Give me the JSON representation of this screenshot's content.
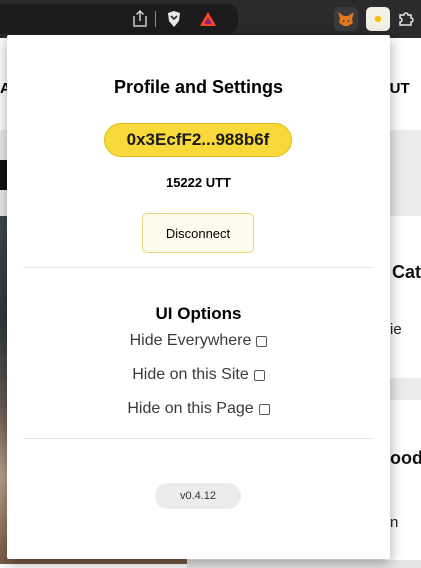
{
  "browser": {
    "toolbar_icons": [
      "share-icon",
      "brave-shield-icon",
      "brave-rewards-icon",
      "metamask-fox-icon",
      "extension-active-icon",
      "extensions-puzzle-icon"
    ]
  },
  "background_page": {
    "nav_left": "AV",
    "nav_right": "OUT",
    "heading_1": "Cat",
    "text_1": "ie",
    "heading_2": "ood",
    "text_2": "n"
  },
  "popup": {
    "title": "Profile and Settings",
    "wallet_address": "0x3EcfF2...988b6f",
    "balance": "15222 UTT",
    "disconnect_label": "Disconnect",
    "ui_options_title": "UI Options",
    "options": [
      {
        "label": "Hide Everywhere",
        "checked": false
      },
      {
        "label": "Hide on this Site",
        "checked": false
      },
      {
        "label": "Hide on this Page",
        "checked": false
      }
    ],
    "version": "v0.4.12"
  },
  "colors": {
    "wallet_button_bg": "#f8d93a",
    "wallet_button_border": "#e2b91e",
    "disconnect_bg": "#fdfbee",
    "disconnect_border": "#ecd27a",
    "version_pill_bg": "#ececec",
    "toolbar_bg": "#2b2b2d"
  }
}
